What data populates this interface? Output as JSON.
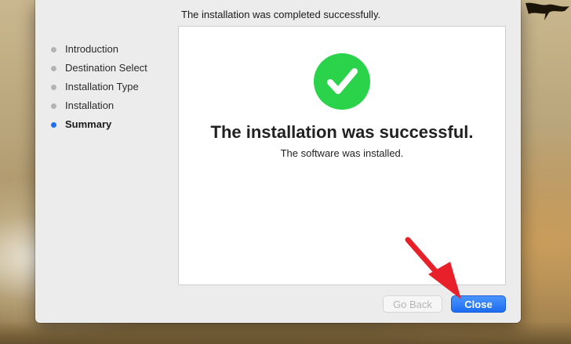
{
  "window": {
    "header": "The installation was completed successfully."
  },
  "sidebar": {
    "steps": [
      {
        "label": "Introduction",
        "active": false
      },
      {
        "label": "Destination Select",
        "active": false
      },
      {
        "label": "Installation Type",
        "active": false
      },
      {
        "label": "Installation",
        "active": false
      },
      {
        "label": "Summary",
        "active": true
      }
    ]
  },
  "main": {
    "status_icon": "checkmark-circle-icon",
    "title": "The installation was successful.",
    "subtitle": "The software was installed."
  },
  "buttons": {
    "back_label": "Go Back",
    "back_enabled": false,
    "close_label": "Close"
  },
  "colors": {
    "accent": "#1f6ff0",
    "success": "#2bd34a",
    "annotation_arrow": "#e8202a"
  }
}
